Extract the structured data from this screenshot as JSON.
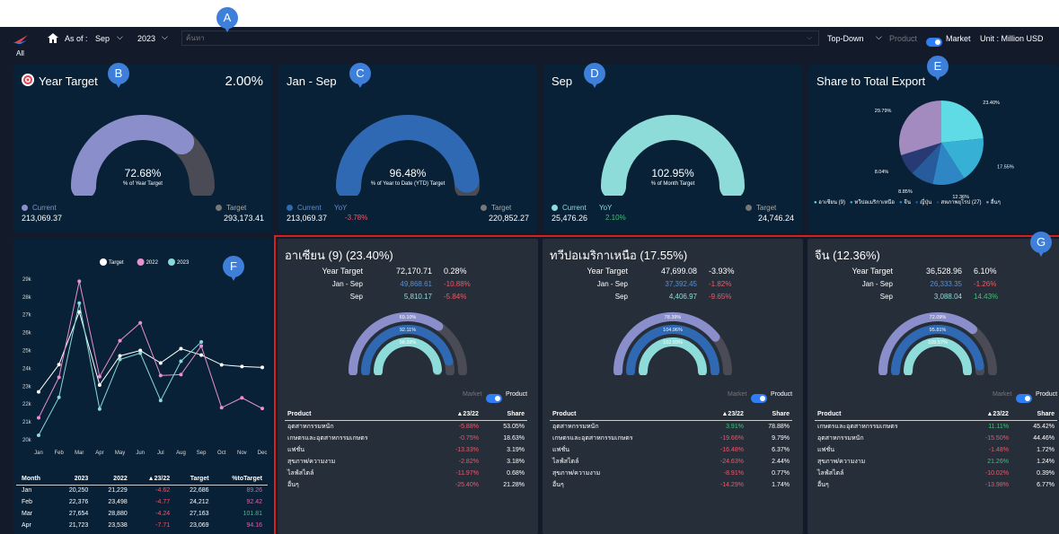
{
  "header": {
    "as_of_label": "As of :",
    "month": "Sep",
    "year": "2023",
    "search_placeholder": "ค้นหา",
    "mode": "Top-Down",
    "product_label": "Product",
    "market_label": "Market",
    "unit": "Unit : Million USD",
    "all_label": "All"
  },
  "markers": {
    "a": "A",
    "b": "B",
    "c": "C",
    "d": "D",
    "e": "E",
    "f": "F",
    "g": "G"
  },
  "year_target": {
    "title": "Year Target",
    "pct": "2.00%",
    "center_value": "72.68%",
    "center_label": "% of Year Target",
    "current_label": "Current",
    "current_value": "213,069.37",
    "target_label": "Target",
    "target_value": "293,173.41",
    "fill": 0.7268
  },
  "ytd": {
    "title": "Jan - Sep",
    "center_value": "96.48%",
    "center_label": "% of Year to Date (YTD) Target",
    "current_label": "Current",
    "yoy_label": "YoY",
    "current_value": "213,069.37",
    "yoy_value": "-3.78%",
    "target_label": "Target",
    "target_value": "220,852.27",
    "fill": 0.9648
  },
  "month": {
    "title": "Sep",
    "center_value": "102.95%",
    "center_label": "% of Month Target",
    "current_label": "Current",
    "yoy_label": "YoY",
    "current_value": "25,476.26",
    "yoy_value": "2.10%",
    "target_label": "Target",
    "target_value": "24,746.24",
    "fill": 1.0
  },
  "share": {
    "title": "Share to Total Export",
    "slices": [
      {
        "label": "23.40%",
        "value": 23.4,
        "color": "#5fdbe6"
      },
      {
        "label": "17.55%",
        "value": 17.55,
        "color": "#36b0d4"
      },
      {
        "label": "12.36%",
        "value": 12.36,
        "color": "#2e86c4"
      },
      {
        "label": "8.85%",
        "value": 8.85,
        "color": "#275b9c"
      },
      {
        "label": "8.04%",
        "value": 8.04,
        "color": "#273a74"
      },
      {
        "label": "29.79%",
        "value": 29.79,
        "color": "#a48bbf"
      }
    ],
    "legend": [
      "อาเซียน (9)",
      "ทวีปอเมริกาเหนือ",
      "จีน",
      "ญี่ปุ่น",
      "สหภาพยุโรป (27)",
      "อื่นๆ"
    ],
    "legend_colors": [
      "#5fdbe6",
      "#36b0d4",
      "#2e86c4",
      "#275b9c",
      "#273a74",
      "#a48bbf"
    ]
  },
  "chart_data": {
    "type": "line",
    "x": [
      "Jan",
      "Feb",
      "Mar",
      "Apr",
      "May",
      "Jun",
      "Jul",
      "Aug",
      "Sep",
      "Oct",
      "Nov",
      "Dec"
    ],
    "yticks": [
      "29k",
      "28k",
      "27k",
      "26k",
      "25k",
      "24k",
      "23k",
      "22k",
      "21k",
      "20k"
    ],
    "ylim": [
      20000,
      29500
    ],
    "series": [
      {
        "name": "Target",
        "color": "#ffffff",
        "values": [
          22686,
          24212,
          27163,
          23069,
          24700,
          25000,
          24300,
          25100,
          24746,
          24200,
          24100,
          24050
        ]
      },
      {
        "name": "2022",
        "color": "#e890d0",
        "values": [
          21229,
          23498,
          28880,
          23538,
          25550,
          26550,
          23600,
          23650,
          25250,
          21800,
          22350,
          21750
        ]
      },
      {
        "name": "2023",
        "color": "#8ad8d8",
        "values": [
          20250,
          22376,
          27654,
          21723,
          24500,
          24850,
          22200,
          24400,
          25476
        ]
      }
    ]
  },
  "monthly_table": {
    "headers": [
      "Month",
      "2023",
      "2022",
      "▲23/22",
      "Target",
      "%toTarget"
    ],
    "rows": [
      [
        "Jan",
        "20,250",
        "21,229",
        "-4.62",
        "22,686",
        "89.26"
      ],
      [
        "Feb",
        "22,376",
        "23,498",
        "-4.77",
        "24,212",
        "92.42"
      ],
      [
        "Mar",
        "27,654",
        "28,880",
        "-4.24",
        "27,163",
        "101.81"
      ],
      [
        "Apr",
        "21,723",
        "23,538",
        "-7.71",
        "23,069",
        "94.16"
      ]
    ]
  },
  "regions": [
    {
      "title": "อาเซียน (9) (23.40%)",
      "year_target_label": "Year Target",
      "year_target_value": "72,170.71",
      "year_target_pct": "0.28%",
      "ytd_label": "Jan - Sep",
      "ytd_value": "49,868.61",
      "ytd_pct": "-10.88%",
      "month_label": "Sep",
      "month_value": "5,810.17",
      "month_pct": "-5.84%",
      "rings": [
        "69.10%",
        "92.11%",
        "98.39%"
      ],
      "ring_fill": [
        0.691,
        0.9211,
        0.9839
      ],
      "market_label": "Market",
      "product_label": "Product",
      "table_headers": [
        "Product",
        "▲23/22",
        "Share"
      ],
      "rows": [
        [
          "อุตสาหกรรมหนัก",
          "-5.88%",
          "53.05%"
        ],
        [
          "เกษตรและอุตสาหกรรมเกษตร",
          "-0.75%",
          "18.63%"
        ],
        [
          "แฟชั่น",
          "-13.33%",
          "3.19%"
        ],
        [
          "สุขภาพ/ความงาม",
          "-2.82%",
          "3.18%"
        ],
        [
          "ไลฟ์สไตล์",
          "-11.97%",
          "0.68%"
        ],
        [
          "อื่นๆ",
          "-25.40%",
          "21.28%"
        ]
      ]
    },
    {
      "title": "ทวีปอเมริกาเหนือ (17.55%)",
      "year_target_label": "Year Target",
      "year_target_value": "47,699.08",
      "year_target_pct": "-3.93%",
      "ytd_label": "Jan - Sep",
      "ytd_value": "37,392.45",
      "ytd_pct": "-1.82%",
      "month_label": "Sep",
      "month_value": "4,406.97",
      "month_pct": "-9.65%",
      "rings": [
        "78.39%",
        "104.96%",
        "102.93%"
      ],
      "ring_fill": [
        0.7839,
        1.0,
        1.0
      ],
      "market_label": "Market",
      "product_label": "Product",
      "table_headers": [
        "Product",
        "▲23/22",
        "Share"
      ],
      "rows": [
        [
          "อุตสาหกรรมหนัก",
          "3.91%",
          "78.88%"
        ],
        [
          "เกษตรและอุตสาหกรรมเกษตร",
          "-19.66%",
          "9.79%"
        ],
        [
          "แฟชั่น",
          "-16.48%",
          "6.37%"
        ],
        [
          "ไลฟ์สไตล์",
          "-24.63%",
          "2.44%"
        ],
        [
          "สุขภาพ/ความงาม",
          "-8.91%",
          "0.77%"
        ],
        [
          "อื่นๆ",
          "-14.29%",
          "1.74%"
        ]
      ]
    },
    {
      "title": "จีน (12.36%)",
      "year_target_label": "Year Target",
      "year_target_value": "36,528.96",
      "year_target_pct": "6.10%",
      "ytd_label": "Jan - Sep",
      "ytd_value": "26,333.35",
      "ytd_pct": "-1.26%",
      "month_label": "Sep",
      "month_value": "3,088.04",
      "month_pct": "14.43%",
      "rings": [
        "72.09%",
        "95.81%",
        "105.57%"
      ],
      "ring_fill": [
        0.7209,
        0.9581,
        1.0
      ],
      "market_label": "Market",
      "product_label": "Product",
      "table_headers": [
        "Product",
        "▲23/22",
        "Share"
      ],
      "rows": [
        [
          "เกษตรและอุตสาหกรรมเกษตร",
          "11.11%",
          "45.42%"
        ],
        [
          "อุตสาหกรรมหนัก",
          "-15.50%",
          "44.46%"
        ],
        [
          "แฟชั่น",
          "-1.48%",
          "1.72%"
        ],
        [
          "สุขภาพ/ความงาม",
          "21.26%",
          "1.24%"
        ],
        [
          "ไลฟ์สไตล์",
          "-10.02%",
          "0.39%"
        ],
        [
          "อื่นๆ",
          "-13.98%",
          "6.77%"
        ]
      ]
    }
  ]
}
